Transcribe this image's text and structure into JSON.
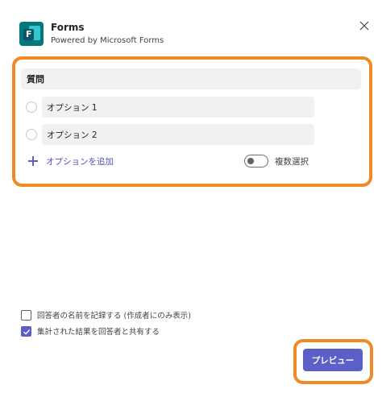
{
  "header": {
    "app_title": "Forms",
    "app_subtitle": "Powered by Microsoft Forms",
    "logo_letter": "F",
    "logo_icon": "microsoft-forms-icon",
    "close_icon": "close-icon"
  },
  "form": {
    "question_label": "質問",
    "options": [
      {
        "label": "オプション 1",
        "selected": false
      },
      {
        "label": "オプション 2",
        "selected": false
      }
    ],
    "add_option_label": "オプションを追加",
    "add_option_icon": "plus-icon",
    "multiple_select_label": "複数選択",
    "multiple_select_on": false
  },
  "settings": {
    "record_names_label": "回答者の名前を記録する (作成者にのみ表示)",
    "record_names_checked": false,
    "share_results_label": "集計された結果を回答者と共有する",
    "share_results_checked": true
  },
  "footer": {
    "preview_label": "プレビュー"
  },
  "colors": {
    "accent": "#5b5fc7",
    "highlight": "#f08a24",
    "logo": "#03787c"
  }
}
